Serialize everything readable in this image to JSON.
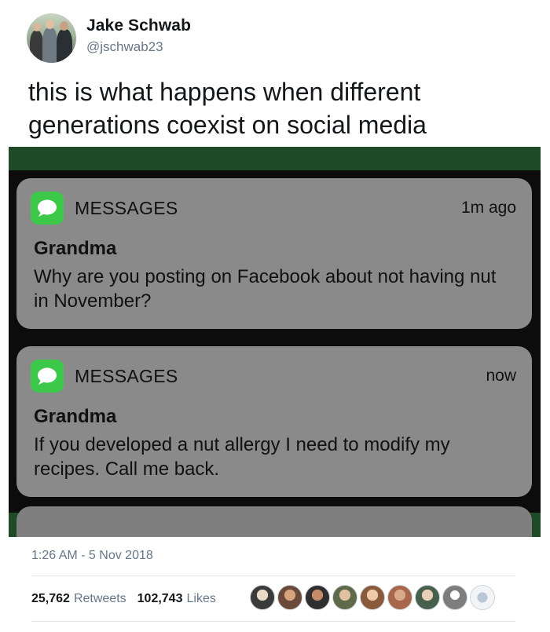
{
  "author": {
    "name": "Jake Schwab",
    "handle": "@jschwab23"
  },
  "tweet_text": "this is what happens when different generations coexist on social media",
  "notifications": [
    {
      "app": "MESSAGES",
      "time": "1m ago",
      "sender": "Grandma",
      "message": "Why are you posting on Facebook about not having nut in November?"
    },
    {
      "app": "MESSAGES",
      "time": "now",
      "sender": "Grandma",
      "message": "If you developed a nut allergy I need to modify my recipes. Call me back."
    }
  ],
  "timestamp": "1:26 AM - 5 Nov 2018",
  "stats": {
    "retweets_count": "25,762",
    "retweets_label": "Retweets",
    "likes_count": "102,743",
    "likes_label": "Likes"
  },
  "icons": {
    "app_icon": "messages-bubble-icon"
  },
  "colors": {
    "handle": "#657786",
    "messages_green": "#3cc94a",
    "notification_bg": "#8a8a8a",
    "media_border": "#1f4a27"
  }
}
